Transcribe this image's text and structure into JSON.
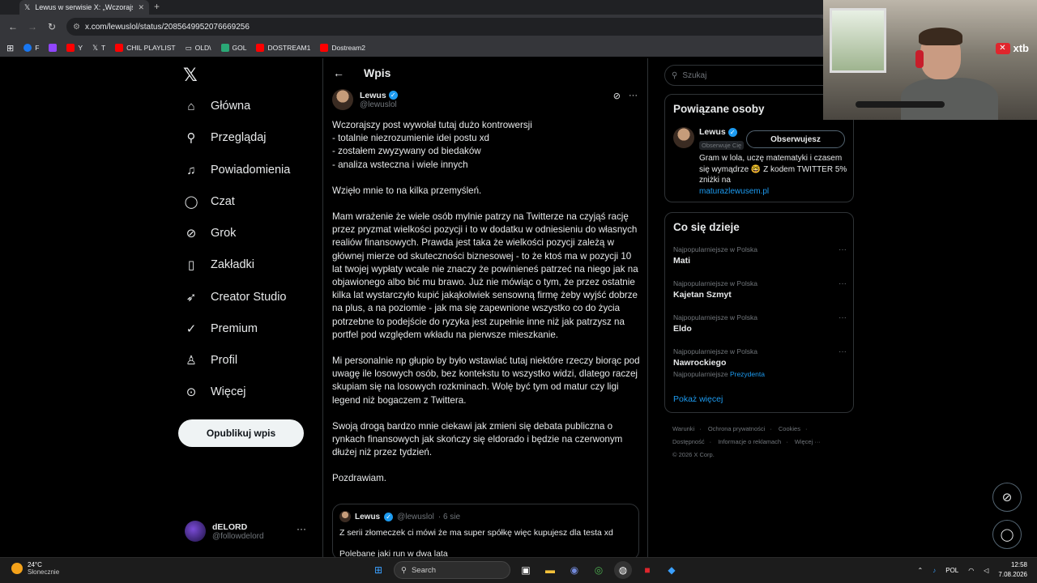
{
  "browser": {
    "tab_title": "Lewus w serwisie X: „Wczorajszy",
    "address": "x.com/lewuslol/status/2085649952076669256",
    "bookmarks": [
      {
        "label": "F",
        "color": "#1877f2"
      },
      {
        "label": "",
        "color": "#9146ff"
      },
      {
        "label": "Y",
        "color": "#ff0000"
      },
      {
        "label": "T",
        "color": "#000000"
      },
      {
        "label": "CHIL PLAYLIST",
        "color": "#ff0000"
      },
      {
        "label": "OLD\\",
        "color": "#5f6368"
      },
      {
        "label": "GOL",
        "color": "#2aa876"
      },
      {
        "label": "DOSTREAM1",
        "color": "#ff0000"
      },
      {
        "label": "Dostream2",
        "color": "#ff0000"
      }
    ]
  },
  "nav": {
    "items": [
      {
        "label": "Główna",
        "icon": "home-icon"
      },
      {
        "label": "Przeglądaj",
        "icon": "search-icon"
      },
      {
        "label": "Powiadomienia",
        "icon": "bell-icon"
      },
      {
        "label": "Czat",
        "icon": "chat-icon"
      },
      {
        "label": "Grok",
        "icon": "grok-icon"
      },
      {
        "label": "Zakładki",
        "icon": "bookmark-icon"
      },
      {
        "label": "Creator Studio",
        "icon": "rocket-icon"
      },
      {
        "label": "Premium",
        "icon": "verified-icon"
      },
      {
        "label": "Profil",
        "icon": "user-icon"
      },
      {
        "label": "Więcej",
        "icon": "more-circle-icon"
      }
    ],
    "post_button": "Opublikuj wpis",
    "account": {
      "name": "dELORD",
      "handle": "@followdelord"
    }
  },
  "post": {
    "header": "Wpis",
    "author": {
      "name": "Lewus",
      "handle": "@lewuslol"
    },
    "paragraphs": [
      "Wczorajszy post wywołał tutaj dużo kontrowersji\n- totalnie niezrozumienie idei postu xd\n- zostałem zwyzywany od biedaków\n- analiza wsteczna i wiele innych",
      "Wzięło mnie to na kilka przemyśleń.",
      "Mam wrażenie że wiele osób mylnie patrzy na Twitterze na czyjąś rację przez pryzmat wielkości pozycji i to w dodatku  w odniesieniu do własnych realiów finansowych. Prawda jest taka że wielkości pozycji zależą w głównej mierze od skuteczności biznesowej - to że ktoś ma w pozycji 10 lat twojej wypłaty wcale nie znaczy że powinieneś patrzeć na niego jak na objawionego albo bić mu brawo. Już nie mówiąc o tym, że przez ostatnie kilka lat wystarczyło kupić jakąkolwiek sensowną firmę żeby wyjść dobrze na plus, a na poziomie - jak ma się zapewnione wszystko co do życia potrzebne to podejście do ryzyka jest zupełnie inne niż jak patrzysz na portfel pod względem wkładu na pierwsze mieszkanie.",
      "Mi personalnie np głupio by było wstawiać tutaj niektóre rzeczy biorąc pod uwagę ile losowych osób, bez kontekstu to wszystko widzi, dlatego raczej skupiam się na losowych rozkminach. Wolę być tym od matur czy ligi legend niż bogaczem z Twittera.",
      "Swoją drogą bardzo mnie ciekawi jak zmieni się debata publiczna o rynkach finansowych jak skończy się eldorado i będzie na czerwonym dłużej niż przez tydzień.",
      "Pozdrawiam."
    ],
    "quote": {
      "name": "Lewus",
      "handle": "@lewuslol",
      "time": "· 6 sie",
      "text": "Z serii złomeczek ci mówi że ma super spółkę więc kupujesz dla testa xd",
      "text2": "Polebane jaki run w dwa lata"
    }
  },
  "sidebar": {
    "search_placeholder": "Szukaj",
    "who": {
      "title": "Powiązane osoby",
      "name": "Lewus",
      "follows_you": "Obserwuje Cię",
      "button": "Obserwujesz",
      "bio": "Gram w lola, uczę matematyki i czasem się wymądrze 🤓 Z kodem TWITTER 5% zniżki na",
      "bio_link": "maturazlewusem.pl"
    },
    "trends": {
      "title": "Co się dzieje",
      "items": [
        {
          "meta": "Najpopularniejsze w Polska",
          "title": "Mati",
          "sub": "",
          "sub_link": ""
        },
        {
          "meta": "Najpopularniejsze w Polska",
          "title": "Kajetan Szmyt",
          "sub": "",
          "sub_link": ""
        },
        {
          "meta": "Najpopularniejsze w Polska",
          "title": "Eldo",
          "sub": "",
          "sub_link": ""
        },
        {
          "meta": "Najpopularniejsze w Polska",
          "title": "Nawrockiego",
          "sub": "Najpopularniejsze",
          "sub_link": "Prezydenta"
        }
      ],
      "show_more": "Pokaż więcej"
    },
    "footer": {
      "links": [
        "Warunki",
        "·",
        "Ochrona prywatności",
        "·",
        "Cookies",
        "·",
        "Dostępność",
        "·",
        "Informacje o reklamach",
        "·",
        "Więcej ···"
      ],
      "copyright": "© 2026 X Corp."
    }
  },
  "overlay": {
    "brand": "xtb"
  },
  "taskbar": {
    "temp": "24°C",
    "weather": "Słonecznie",
    "search": "Search",
    "lang": "POL",
    "time": "12:58",
    "date": "7.08.2026"
  }
}
